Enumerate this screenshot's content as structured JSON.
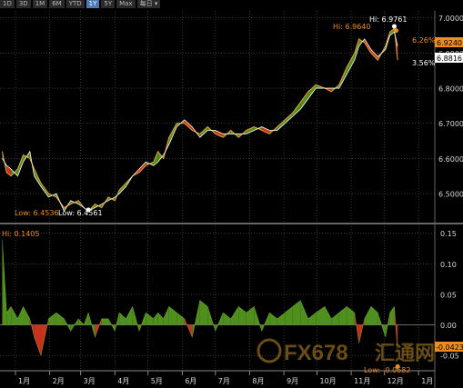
{
  "toolbar": {
    "ranges": [
      "1D",
      "3D",
      "1M",
      "6M",
      "YTD",
      "1Y",
      "5Y",
      "Max"
    ],
    "active": "1Y",
    "extra_label": "每日 ▾"
  },
  "colors": {
    "background": "#000000",
    "grid": "#555555",
    "positive_fill": "#4f8f1e",
    "negative_fill": "#c8331e",
    "line_upper": "#f0a030",
    "line_lower": "#ffffff",
    "current_tag": "#f08c1e",
    "axis_text": "#d8d8d8"
  },
  "chart_data": [
    {
      "type": "area",
      "panel": "upper",
      "ylim": [
        6.42,
        7.02
      ],
      "yticks": [
        6.5,
        6.6,
        6.7,
        6.8,
        6.9,
        7.0
      ],
      "ytick_labels": [
        "6.5000",
        "6.6000",
        "6.7000",
        "6.8000",
        "6.9000",
        "7.0000"
      ],
      "x": [
        "2018-12-20",
        "2018-12-24",
        "2018-12-28",
        "2019-01-03",
        "2019-01-08",
        "2019-01-14",
        "2019-01-18",
        "2019-01-24",
        "2019-01-31",
        "2019-02-07",
        "2019-02-14",
        "2019-02-20",
        "2019-02-27",
        "2019-03-04",
        "2019-03-08",
        "2019-03-14",
        "2019-03-20",
        "2019-03-26",
        "2019-04-01",
        "2019-04-05",
        "2019-04-11",
        "2019-04-17",
        "2019-04-23",
        "2019-04-29",
        "2019-05-06",
        "2019-05-10",
        "2019-05-15",
        "2019-05-20",
        "2019-05-27",
        "2019-06-03",
        "2019-06-10",
        "2019-06-17",
        "2019-06-24",
        "2019-07-01",
        "2019-07-08",
        "2019-07-15",
        "2019-07-22",
        "2019-07-29",
        "2019-08-05",
        "2019-08-12",
        "2019-08-19",
        "2019-08-26",
        "2019-09-02",
        "2019-09-09",
        "2019-09-16",
        "2019-09-23",
        "2019-09-30",
        "2019-10-08",
        "2019-10-14",
        "2019-10-21",
        "2019-10-28",
        "2019-11-04",
        "2019-11-08",
        "2019-11-13",
        "2019-11-19",
        "2019-11-25",
        "2019-12-02",
        "2019-12-06",
        "2019-12-10",
        "2019-12-13"
      ],
      "series": [
        {
          "values": [
            6.62,
            6.56,
            6.55,
            6.57,
            6.61,
            6.6,
            6.57,
            6.53,
            6.5,
            6.49,
            6.46,
            6.47,
            6.48,
            6.46,
            6.45,
            6.47,
            6.46,
            6.49,
            6.48,
            6.51,
            6.53,
            6.55,
            6.56,
            6.58,
            6.59,
            6.62,
            6.6,
            6.66,
            6.7,
            6.7,
            6.68,
            6.67,
            6.69,
            6.67,
            6.66,
            6.68,
            6.66,
            6.68,
            6.69,
            6.68,
            6.67,
            6.69,
            6.71,
            6.73,
            6.76,
            6.79,
            6.81,
            6.8,
            6.79,
            6.81,
            6.86,
            6.9,
            6.94,
            6.93,
            6.9,
            6.88,
            6.92,
            6.96,
            6.97,
            6.88
          ]
        },
        {
          "values": [
            6.6,
            6.58,
            6.57,
            6.55,
            6.59,
            6.62,
            6.55,
            6.52,
            6.49,
            6.5,
            6.45,
            6.48,
            6.47,
            6.46,
            6.45,
            6.46,
            6.47,
            6.48,
            6.49,
            6.5,
            6.52,
            6.55,
            6.57,
            6.59,
            6.58,
            6.59,
            6.61,
            6.64,
            6.69,
            6.71,
            6.69,
            6.66,
            6.68,
            6.68,
            6.67,
            6.67,
            6.67,
            6.67,
            6.68,
            6.69,
            6.68,
            6.68,
            6.7,
            6.72,
            6.74,
            6.77,
            6.8,
            6.8,
            6.8,
            6.8,
            6.84,
            6.88,
            6.92,
            6.94,
            6.91,
            6.89,
            6.91,
            6.95,
            6.96,
            6.92
          ]
        }
      ],
      "annotations": {
        "hi_upper": "Hi: 6.9640",
        "hi_lower": "Hi: 6.9761",
        "low_upper": "Low: 6.4536",
        "low_lower": "Low: 6.4561",
        "current_upper": "6.9240",
        "current_lower": "6.8816",
        "pct_upper": "6.26%",
        "pct_lower": "3.56%"
      }
    },
    {
      "type": "area",
      "panel": "lower",
      "ylim": [
        -0.075,
        0.16
      ],
      "yticks": [
        0.15,
        0.1,
        0.05,
        0.0,
        -0.05
      ],
      "ytick_labels": [
        "0.15",
        "0.10",
        "0.05",
        "0.00",
        "-0.05"
      ],
      "x": [
        "2018-12-20",
        "2018-12-24",
        "2018-12-28",
        "2019-01-03",
        "2019-01-08",
        "2019-01-14",
        "2019-01-18",
        "2019-01-24",
        "2019-01-31",
        "2019-02-07",
        "2019-02-14",
        "2019-02-20",
        "2019-02-27",
        "2019-03-04",
        "2019-03-08",
        "2019-03-14",
        "2019-03-20",
        "2019-03-26",
        "2019-04-01",
        "2019-04-05",
        "2019-04-11",
        "2019-04-17",
        "2019-04-23",
        "2019-04-29",
        "2019-05-06",
        "2019-05-10",
        "2019-05-15",
        "2019-05-20",
        "2019-05-27",
        "2019-06-03",
        "2019-06-10",
        "2019-06-17",
        "2019-06-24",
        "2019-07-01",
        "2019-07-08",
        "2019-07-15",
        "2019-07-22",
        "2019-07-29",
        "2019-08-05",
        "2019-08-12",
        "2019-08-19",
        "2019-08-26",
        "2019-09-02",
        "2019-09-09",
        "2019-09-16",
        "2019-09-23",
        "2019-09-30",
        "2019-10-08",
        "2019-10-14",
        "2019-10-21",
        "2019-10-28",
        "2019-11-04",
        "2019-11-08",
        "2019-11-13",
        "2019-11-19",
        "2019-11-25",
        "2019-12-02",
        "2019-12-06",
        "2019-12-10",
        "2019-12-13"
      ],
      "values": [
        0.14,
        0.02,
        0.03,
        0.01,
        0.03,
        0.01,
        -0.02,
        -0.05,
        0.01,
        0.02,
        0.01,
        -0.01,
        0.01,
        0.0,
        0.02,
        -0.02,
        0.01,
        0.01,
        -0.01,
        0.02,
        0.01,
        0.03,
        -0.01,
        0.02,
        0.01,
        0.02,
        0.01,
        0.03,
        0.02,
        0.01,
        -0.02,
        0.04,
        0.03,
        -0.01,
        0.02,
        0.01,
        0.03,
        0.02,
        0.03,
        -0.01,
        0.02,
        0.01,
        0.02,
        0.03,
        0.04,
        0.01,
        0.02,
        0.03,
        0.01,
        0.02,
        0.03,
        0.02,
        -0.03,
        0.01,
        0.03,
        0.02,
        -0.02,
        0.02,
        0.03,
        -0.0423
      ],
      "annotations": {
        "hi": "Hi: 0.1405",
        "low": "Low: -0.0682",
        "current": "-0.0423"
      }
    }
  ],
  "x_axis": {
    "month_labels": [
      "1月",
      "2月",
      "3月",
      "4月",
      "5月",
      "6月",
      "7月",
      "8月",
      "9月",
      "10月",
      "11月",
      "12月",
      "1月"
    ],
    "month_starts": [
      "2019-01-01",
      "2019-02-01",
      "2019-03-01",
      "2019-04-01",
      "2019-05-01",
      "2019-06-01",
      "2019-07-01",
      "2019-08-01",
      "2019-09-01",
      "2019-10-01",
      "2019-11-01",
      "2019-12-01",
      "2020-01-01"
    ],
    "range": [
      "2018-12-18",
      "2020-01-14"
    ]
  },
  "watermark": {
    "brand_text": "FX678",
    "brand_cn": "汇通网"
  }
}
